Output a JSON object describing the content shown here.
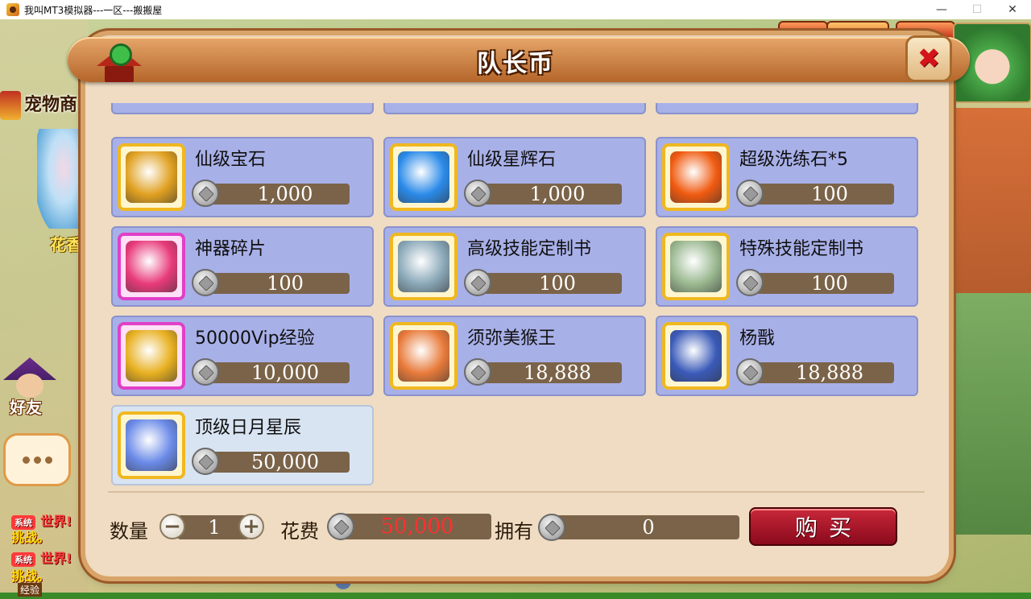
{
  "window": {
    "title": "我叫MT3模拟器---一区---搬搬屋",
    "minimize": "—",
    "maximize": "☐",
    "close": "✕"
  },
  "background": {
    "pet_shop": "宠物商",
    "npc_name": "花香",
    "friends": "好友",
    "exp_label": "经验",
    "chat": [
      {
        "tag": "系统",
        "channel": "世界!",
        "text": "挑战。"
      },
      {
        "tag": "系统",
        "channel": "世界!",
        "text": "挑战。"
      }
    ]
  },
  "panel": {
    "title": "队长币",
    "close_icon": "✖"
  },
  "items": [
    {
      "name": "仙级宝石",
      "price": "1,000",
      "frame": "gold",
      "icon": "treasure-chest-icon",
      "color": "#e0a020"
    },
    {
      "name": "仙级星辉石",
      "price": "1,000",
      "frame": "gold",
      "icon": "blue-gem-icon",
      "color": "#2a8ae8"
    },
    {
      "name": "超级洗练石*5",
      "price": "100",
      "frame": "gold",
      "icon": "fire-orb-icon",
      "color": "#f05a10"
    },
    {
      "name": "神器碎片",
      "price": "100",
      "frame": "purple",
      "icon": "artifact-shard-icon",
      "color": "#e83a7a"
    },
    {
      "name": "高级技能定制书",
      "price": "100",
      "frame": "gold",
      "icon": "skill-book-icon",
      "color": "#8aa8b8"
    },
    {
      "name": "特殊技能定制书",
      "price": "100",
      "frame": "gold",
      "icon": "skill-book-icon",
      "color": "#9ab890"
    },
    {
      "name": "50000Vip经验",
      "price": "10,000",
      "frame": "purple",
      "icon": "vip-card-icon",
      "color": "#e8b020"
    },
    {
      "name": "须弥美猴王",
      "price": "18,888",
      "frame": "gold",
      "icon": "monkey-king-portrait-icon",
      "color": "#e87a3a"
    },
    {
      "name": "杨戬",
      "price": "18,888",
      "frame": "gold",
      "icon": "yang-jian-portrait-icon",
      "color": "#3a5ab8"
    },
    {
      "name": "顶级日月星辰",
      "price": "50,000",
      "frame": "gold",
      "icon": "starry-beast-icon",
      "color": "#6a8ae8"
    }
  ],
  "footer": {
    "quantity_label": "数量",
    "quantity": "1",
    "minus": "−",
    "plus": "+",
    "cost_label": "花费",
    "cost": "50,000",
    "owned_label": "拥有",
    "owned": "0",
    "buy_label": "购买"
  }
}
